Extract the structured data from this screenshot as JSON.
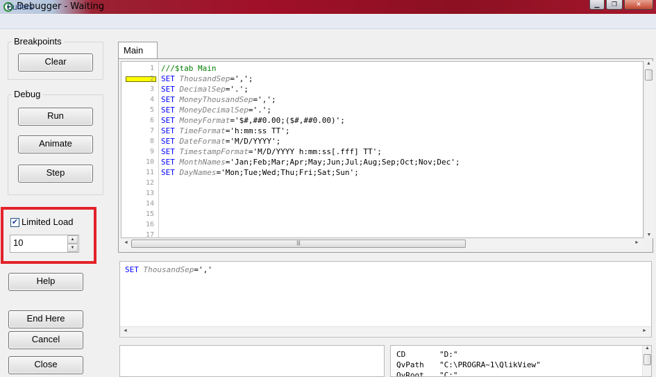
{
  "window": {
    "title": "Debugger - Waiting"
  },
  "menu": {
    "buffers": "Buffers"
  },
  "breakpoints": {
    "legend": "Breakpoints",
    "clear": "Clear"
  },
  "debug": {
    "legend": "Debug",
    "run": "Run",
    "animate": "Animate",
    "step": "Step"
  },
  "limited_load": {
    "label": "Limited Load",
    "checked": true,
    "check_mark": "✔",
    "value": "10"
  },
  "buttons": {
    "help": "Help",
    "end_here": "End Here",
    "cancel": "Cancel",
    "close": "Close"
  },
  "tabs": [
    {
      "label": "Main",
      "active": true
    }
  ],
  "editor": {
    "current_line": 2,
    "line_numbers": [
      "1",
      "2",
      "3",
      "4",
      "5",
      "6",
      "7",
      "8",
      "9",
      "10",
      "11",
      "12",
      "13",
      "14",
      "15",
      "16",
      "17"
    ],
    "lines": [
      {
        "comment": "///$tab Main"
      },
      {
        "kw": "SET",
        "var": "ThousandSep",
        "val": "=',';"
      },
      {
        "kw": "SET",
        "var": "DecimalSep",
        "val": "='.';"
      },
      {
        "kw": "SET",
        "var": "MoneyThousandSep",
        "val": "=',';"
      },
      {
        "kw": "SET",
        "var": "MoneyDecimalSep",
        "val": "='.';"
      },
      {
        "kw": "SET",
        "var": "MoneyFormat",
        "val": "='$#,##0.00;($#,##0.00)';"
      },
      {
        "kw": "SET",
        "var": "TimeFormat",
        "val": "='h:mm:ss TT';"
      },
      {
        "kw": "SET",
        "var": "DateFormat",
        "val": "='M/D/YYYY';"
      },
      {
        "kw": "SET",
        "var": "TimestampFormat",
        "val": "='M/D/YYYY h:mm:ss[.fff] TT';"
      },
      {
        "kw": "SET",
        "var": "MonthNames",
        "val": "='Jan;Feb;Mar;Apr;May;Jun;Jul;Aug;Sep;Oct;Nov;Dec';"
      },
      {
        "kw": "SET",
        "var": "DayNames",
        "val": "='Mon;Tue;Wed;Thu;Fri;Sat;Sun';"
      }
    ]
  },
  "statement": {
    "kw": "SET",
    "var": "ThousandSep",
    "val": "=','"
  },
  "variables": [
    {
      "name": "CD",
      "value": "\"D:\""
    },
    {
      "name": "QvPath",
      "value": "\"C:\\PROGRA~1\\QlikView\""
    },
    {
      "name": "QvRoot",
      "value": "\"C:\""
    }
  ],
  "icons": {
    "app": "qlikview-icon",
    "minimize": "minimize-icon",
    "maximize": "maximize-icon",
    "close": "close-icon",
    "scroll_up": "▲",
    "scroll_down": "▼",
    "scroll_left": "◄",
    "scroll_right": "►",
    "grip": "|||"
  },
  "colors": {
    "keyword": "#0000ff",
    "variable": "#808080",
    "comment": "#008000",
    "breakpoint": "#ffff00",
    "highlight_border": "#e3222a"
  }
}
